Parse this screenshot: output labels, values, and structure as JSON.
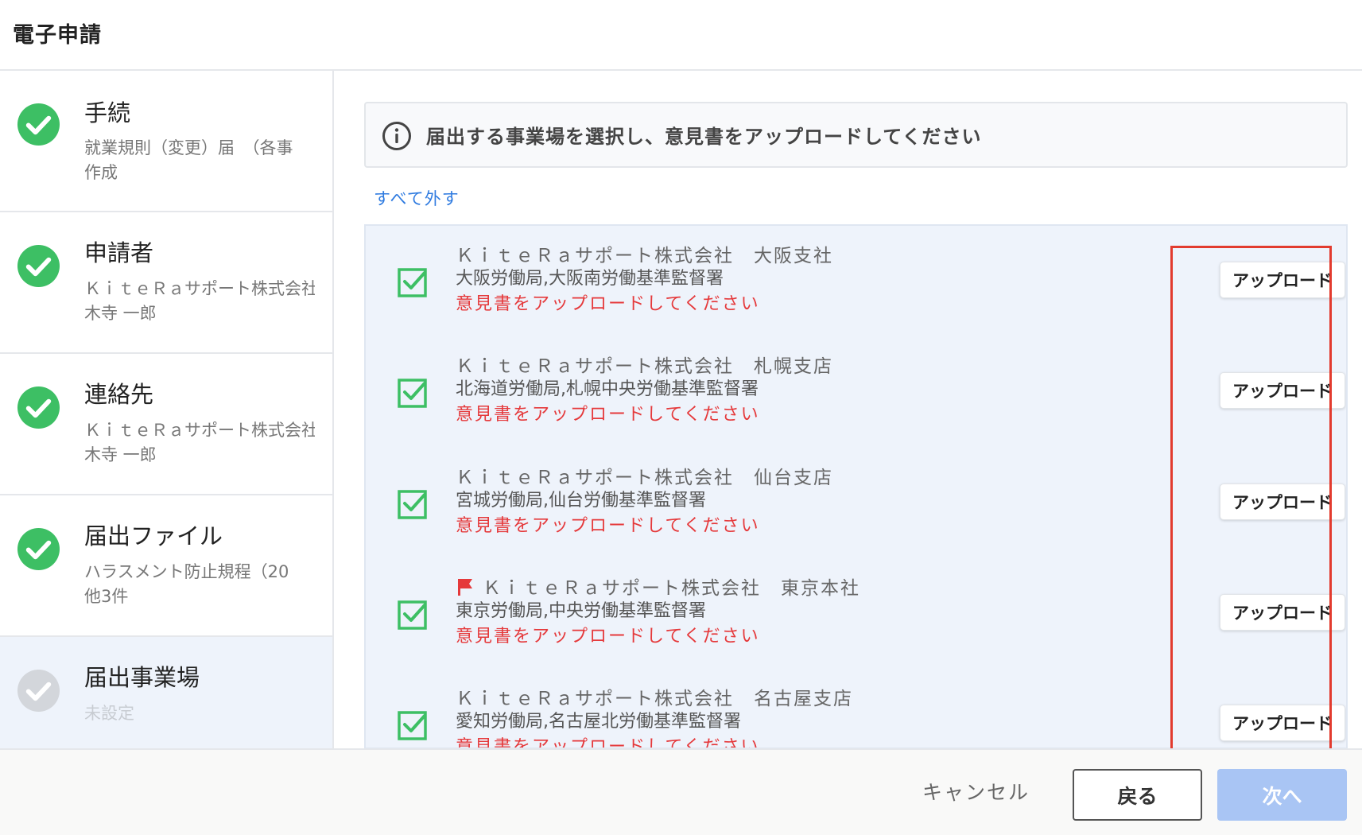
{
  "header": {
    "title": "電子申請"
  },
  "sidebar": {
    "steps": [
      {
        "title": "手続",
        "sub1": "就業規則（変更）届　（各事",
        "sub2": "作成",
        "status": "done"
      },
      {
        "title": "申請者",
        "sub1": "ＫｉｔｅＲａサポート株式会社",
        "sub2": "木寺 一郎",
        "status": "done"
      },
      {
        "title": "連絡先",
        "sub1": "ＫｉｔｅＲａサポート株式会社",
        "sub2": "木寺 一郎",
        "status": "done"
      },
      {
        "title": "届出ファイル",
        "sub1": "ハラスメント防止規程（20",
        "sub2": "他3件",
        "status": "done"
      },
      {
        "title": "届出事業場",
        "sub1": "未設定",
        "status": "current"
      }
    ]
  },
  "main": {
    "notice": {
      "icon": "info-icon",
      "text": "届出する事業場を選択し、意見書をアップロードしてください"
    },
    "deselect_all": "すべて外す",
    "offices": [
      {
        "company": "ＫｉｔｅＲａサポート株式会社　大阪支社",
        "office": "大阪労働局,大阪南労働基準監督署",
        "warning": "意見書をアップロードしてください",
        "upload_label": "アップロード",
        "checked": true,
        "flag": false
      },
      {
        "company": "ＫｉｔｅＲａサポート株式会社　札幌支店",
        "office": "北海道労働局,札幌中央労働基準監督署",
        "warning": "意見書をアップロードしてください",
        "upload_label": "アップロード",
        "checked": true,
        "flag": false
      },
      {
        "company": "ＫｉｔｅＲａサポート株式会社　仙台支店",
        "office": "宮城労働局,仙台労働基準監督署",
        "warning": "意見書をアップロードしてください",
        "upload_label": "アップロード",
        "checked": true,
        "flag": false
      },
      {
        "company": "ＫｉｔｅＲａサポート株式会社　東京本社",
        "office": "東京労働局,中央労働基準監督署",
        "warning": "意見書をアップロードしてください",
        "upload_label": "アップロード",
        "checked": true,
        "flag": true
      },
      {
        "company": "ＫｉｔｅＲａサポート株式会社　名古屋支店",
        "office": "愛知労働局,名古屋北労働基準監督署",
        "warning": "意見書をアップロードしてください",
        "upload_label": "アップロード",
        "checked": true,
        "flag": false
      }
    ]
  },
  "footer": {
    "cancel_label": "キャンセル",
    "back_label": "戻る",
    "next_label": "次へ"
  },
  "colors": {
    "success": "#3dbf64",
    "pending": "#d3d6db",
    "warning": "#e5393b",
    "link": "#2f7be0",
    "highlight": "#e23b2e",
    "next_disabled": "#a9c5f4",
    "checkbox": "#3dbf64"
  }
}
